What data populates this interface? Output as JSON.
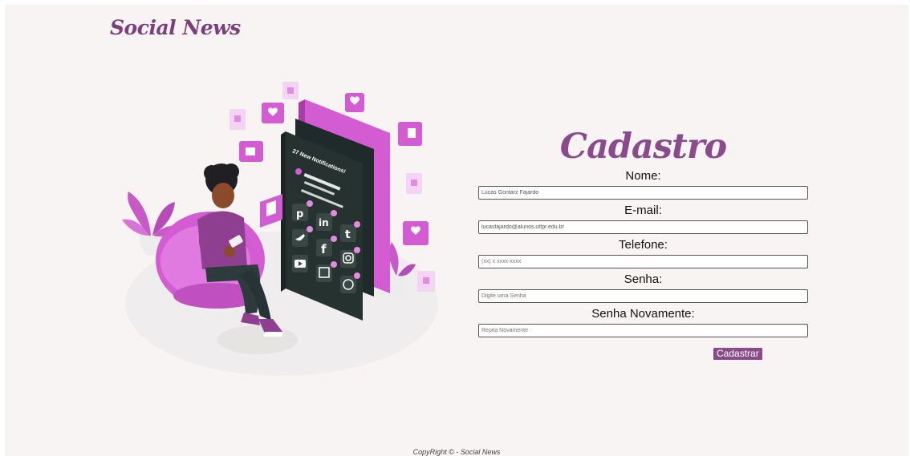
{
  "header": {
    "brand": "Social News"
  },
  "illustration": {
    "notification_text": "27 New Notifications!",
    "social_icons": [
      "pinterest-icon",
      "linkedin-icon",
      "tumblr-icon",
      "twitter-icon",
      "facebook-icon",
      "instagram-icon",
      "youtube-icon",
      "twitch-icon",
      "whatsapp-icon"
    ]
  },
  "form": {
    "title": "Cadastro",
    "fields": [
      {
        "label": "Nome:",
        "value": "Lucas Gontarz Fajardo",
        "placeholder": ""
      },
      {
        "label": "E-mail:",
        "value": "lucasfajardo@alunos.utfpr.edu.br",
        "placeholder": ""
      },
      {
        "label": "Telefone:",
        "value": "",
        "placeholder": "(xx) x xxxx-xxxx"
      },
      {
        "label": "Senha:",
        "value": "",
        "placeholder": "Digite uma Senha"
      },
      {
        "label": "Senha Novamente:",
        "value": "",
        "placeholder": "Repita Novamente"
      }
    ],
    "submit_label": "Cadastrar"
  },
  "footer": {
    "text": "CopyRight © - Social News"
  },
  "colors": {
    "accent": "#8a4a8b",
    "background": "#f8f4f4",
    "illustration_pink": "#d45fd3"
  }
}
